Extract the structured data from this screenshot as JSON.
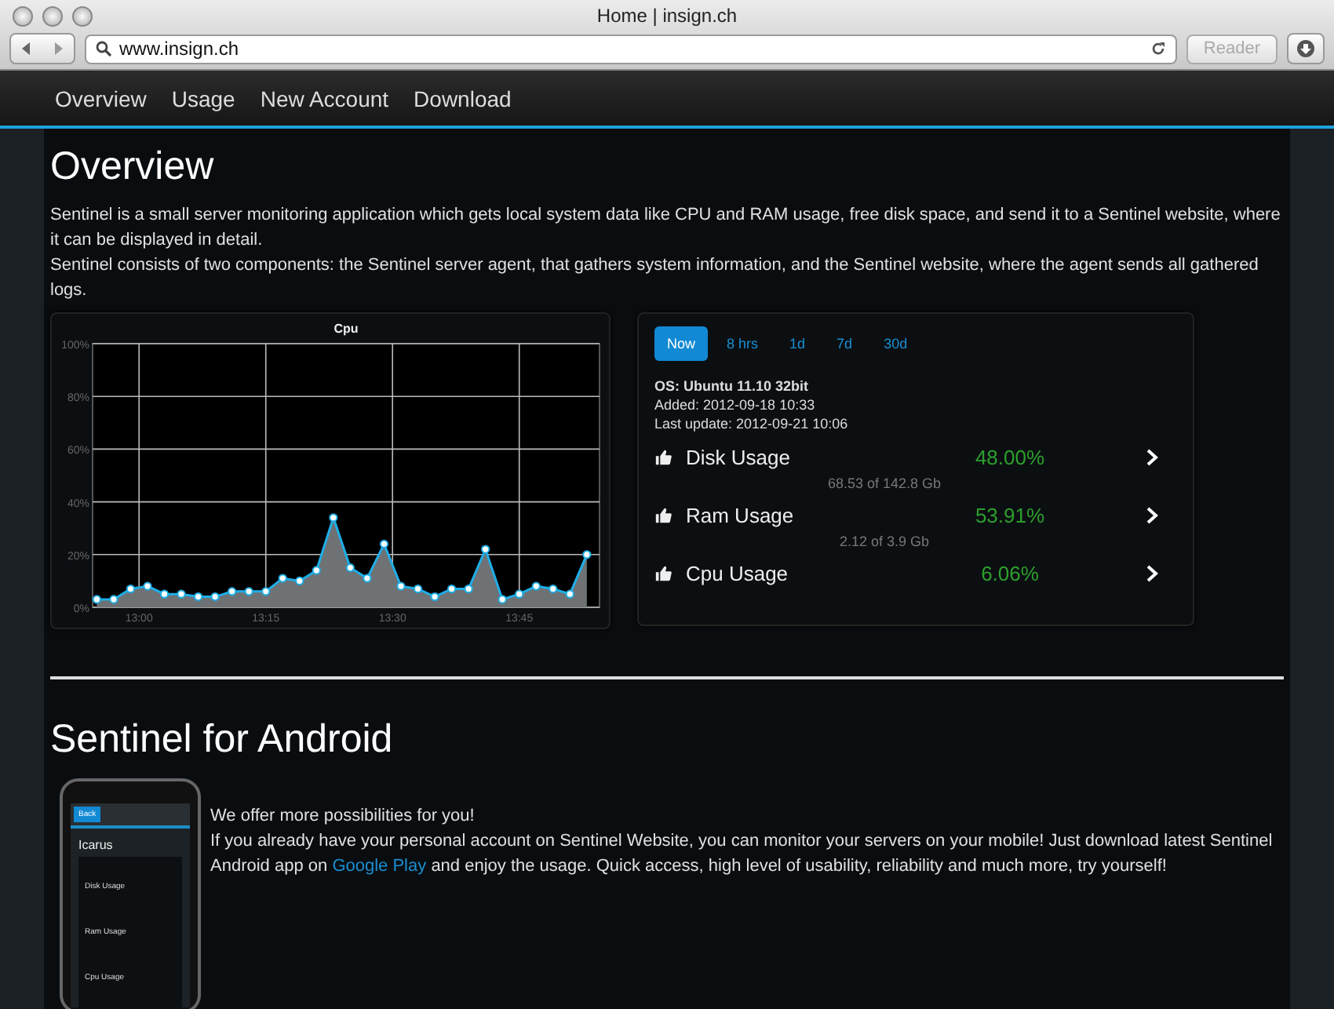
{
  "window": {
    "title": "Home | insign.ch",
    "url": "www.insign.ch",
    "reader_button": "Reader"
  },
  "nav": {
    "items": [
      {
        "label": "Overview"
      },
      {
        "label": "Usage"
      },
      {
        "label": "New Account"
      },
      {
        "label": "Download"
      }
    ]
  },
  "overview": {
    "heading": "Overview",
    "paragraphs": [
      "Sentinel is a small server monitoring application which gets local system data like CPU and RAM usage, free disk space, and send it to a Sentinel website, where it can be displayed in detail.",
      "Sentinel consists of two components: the Sentinel server agent, that gathers system information, and the Sentinel website, where the agent sends all gathered logs."
    ],
    "cpu_chart": {
      "chart_data": {
        "type": "area",
        "title": "Cpu",
        "grid": true,
        "x": [
          775,
          777,
          779,
          781,
          783,
          785,
          787,
          789,
          791,
          793,
          795,
          797,
          799,
          801,
          803,
          805,
          807,
          809,
          811,
          813,
          815,
          817,
          819,
          821,
          823,
          825,
          827,
          829,
          831,
          833
        ],
        "series": [
          {
            "color": "#1eaee8",
            "values": [
              3,
              3,
              7,
              8,
              5,
              5,
              4,
              4,
              6,
              6,
              6,
              11,
              10,
              14,
              34,
              15,
              11,
              24,
              8,
              7,
              4,
              7,
              7,
              22,
              3,
              5,
              8,
              7,
              5,
              20
            ]
          }
        ],
        "xlim": [
          774.5,
          834.5
        ],
        "ylim": [
          0,
          100
        ],
        "xticks": [
          {
            "value": 780,
            "label": "13:00"
          },
          {
            "value": 795,
            "label": "13:15"
          },
          {
            "value": 810,
            "label": "13:30"
          },
          {
            "value": 825,
            "label": "13:45"
          }
        ],
        "yticks": [
          {
            "value": 0,
            "label": "0%"
          },
          {
            "value": 20,
            "label": "20%"
          },
          {
            "value": 40,
            "label": "40%"
          },
          {
            "value": 60,
            "label": "60%"
          },
          {
            "value": 80,
            "label": "80%"
          },
          {
            "value": 100,
            "label": "100%"
          }
        ]
      }
    },
    "stats": {
      "ranges": [
        {
          "label": "Now",
          "selected": true
        },
        {
          "label": "8 hrs",
          "selected": false
        },
        {
          "label": "1d",
          "selected": false
        },
        {
          "label": "7d",
          "selected": false
        },
        {
          "label": "30d",
          "selected": false
        }
      ],
      "os": "OS: Ubuntu 11.10 32bit",
      "added": "Added: 2012-09-18 10:33",
      "last_update": "Last update: 2012-09-21 10:06",
      "metrics": [
        {
          "label": "Disk Usage",
          "value": "48.00%",
          "detail": "68.53 of 142.8 Gb"
        },
        {
          "label": "Ram Usage",
          "value": "53.91%",
          "detail": "2.12 of 3.9 Gb"
        },
        {
          "label": "Cpu Usage",
          "value": "6.06%"
        }
      ]
    }
  },
  "android": {
    "heading": "Sentinel for Android",
    "lead": "We offer more possibilities for you!",
    "body_start": "If you already have your personal account on Sentinel Website, you can monitor your servers on your mobile! Just download latest Sentinel Android app on",
    "link": "Google Play",
    "body_end": "and enjoy the usage. Quick access, high level of usability, reliability and much more, try yourself!",
    "phone": {
      "back": "Back",
      "title": "Icarus",
      "metrics": [
        {
          "label": "Disk Usage"
        },
        {
          "label": "Ram Usage"
        },
        {
          "label": "Cpu Usage"
        }
      ]
    }
  }
}
